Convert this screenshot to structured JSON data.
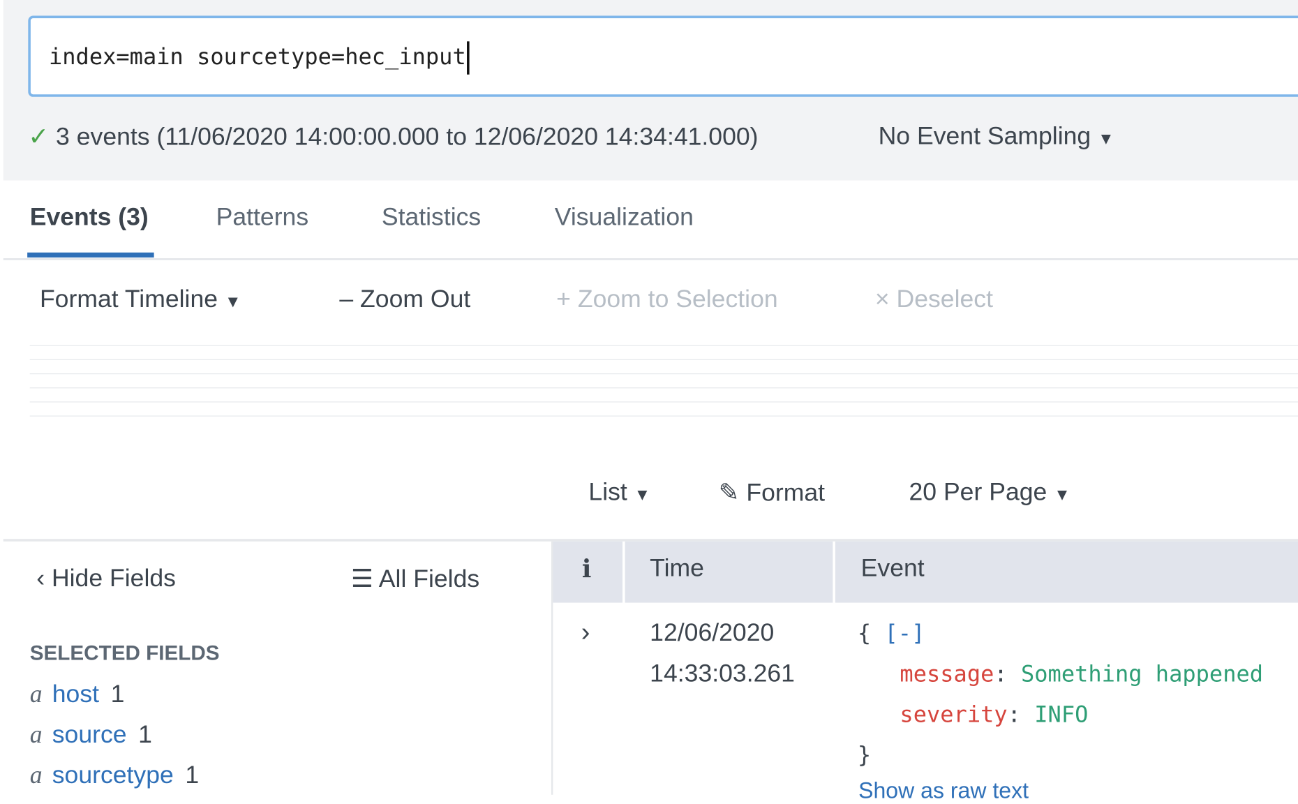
{
  "search": {
    "query": "index=main sourcetype=hec_input"
  },
  "status": {
    "summary": "3 events (11/06/2020 14:00:00.000 to 12/06/2020 14:34:41.000)",
    "sampling": "No Event Sampling"
  },
  "tabs": [
    {
      "label": "Events (3)",
      "active": true
    },
    {
      "label": "Patterns"
    },
    {
      "label": "Statistics"
    },
    {
      "label": "Visualization"
    }
  ],
  "timeline": {
    "format": "Format Timeline",
    "zoom_out": "Zoom Out",
    "zoom_selection": "Zoom to Selection",
    "deselect": "Deselect"
  },
  "results_controls": {
    "list": "List",
    "format": "Format",
    "per_page": "20 Per Page"
  },
  "fields": {
    "hide": "Hide Fields",
    "all": "All Fields",
    "selected_heading": "SELECTED FIELDS",
    "selected": [
      {
        "type": "a",
        "name": "host",
        "count": "1"
      },
      {
        "type": "a",
        "name": "source",
        "count": "1"
      },
      {
        "type": "a",
        "name": "sourcetype",
        "count": "1"
      }
    ]
  },
  "table": {
    "headers": {
      "info": "i",
      "time": "Time",
      "event": "Event"
    },
    "rows": [
      {
        "date": "12/06/2020",
        "time": "14:33:03.261",
        "open": "{",
        "collapse": "[-]",
        "props": [
          {
            "key": "message",
            "value": "Something happened"
          },
          {
            "key": "severity",
            "value": "INFO"
          }
        ],
        "close": "}",
        "raw_link": "Show as raw text"
      }
    ]
  },
  "colors": {
    "accent": "#2f70b8",
    "key": "#d6453d",
    "value": "#2e9e75",
    "success": "#4aa34a"
  }
}
